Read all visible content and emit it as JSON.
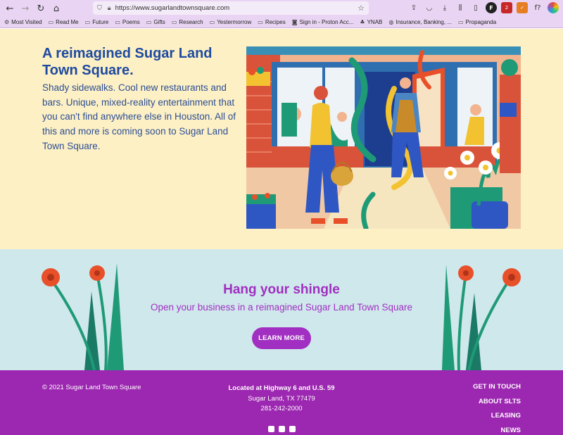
{
  "browser": {
    "url": "https://www.sugarlandtownsquare.com",
    "bookmarks": [
      "Most Visited",
      "Read Me",
      "Future",
      "Poems",
      "Gifts",
      "Research",
      "Yestermorrow",
      "Recipes",
      "Sign in - Proton Acc...",
      "YNAB",
      "Insurance, Banking, ...",
      "Propaganda"
    ],
    "ext_badges": [
      "F",
      "2",
      "f?"
    ]
  },
  "hero": {
    "title": "A reimagined Sugar Land Town Square.",
    "body": "Shady sidewalks. Cool new restaurants and bars. Unique, mixed-reality entertainment that you can't find anywhere else in Houston. All of this and more is coming soon to Sugar Land Town Square."
  },
  "cta": {
    "title": "Hang your shingle",
    "subtitle": "Open your business in a reimagined Sugar Land Town Square",
    "button": "LEARN MORE"
  },
  "footer": {
    "copyright": "© 2021 Sugar Land Town Square",
    "location": "Located at Highway 6 and U.S. 59",
    "city": "Sugar Land, TX 77479",
    "phone": "281-242-2000",
    "nav": [
      "GET IN TOUCH",
      "ABOUT SLTS",
      "LEASING",
      "NEWS"
    ]
  },
  "colors": {
    "hero_bg": "#fdf0c4",
    "heading_blue": "#1e4aa0",
    "cta_bg": "#cfe8ec",
    "brand_purple": "#9c27b0",
    "flower_red": "#e8502a",
    "stem_green": "#1f9a76"
  }
}
